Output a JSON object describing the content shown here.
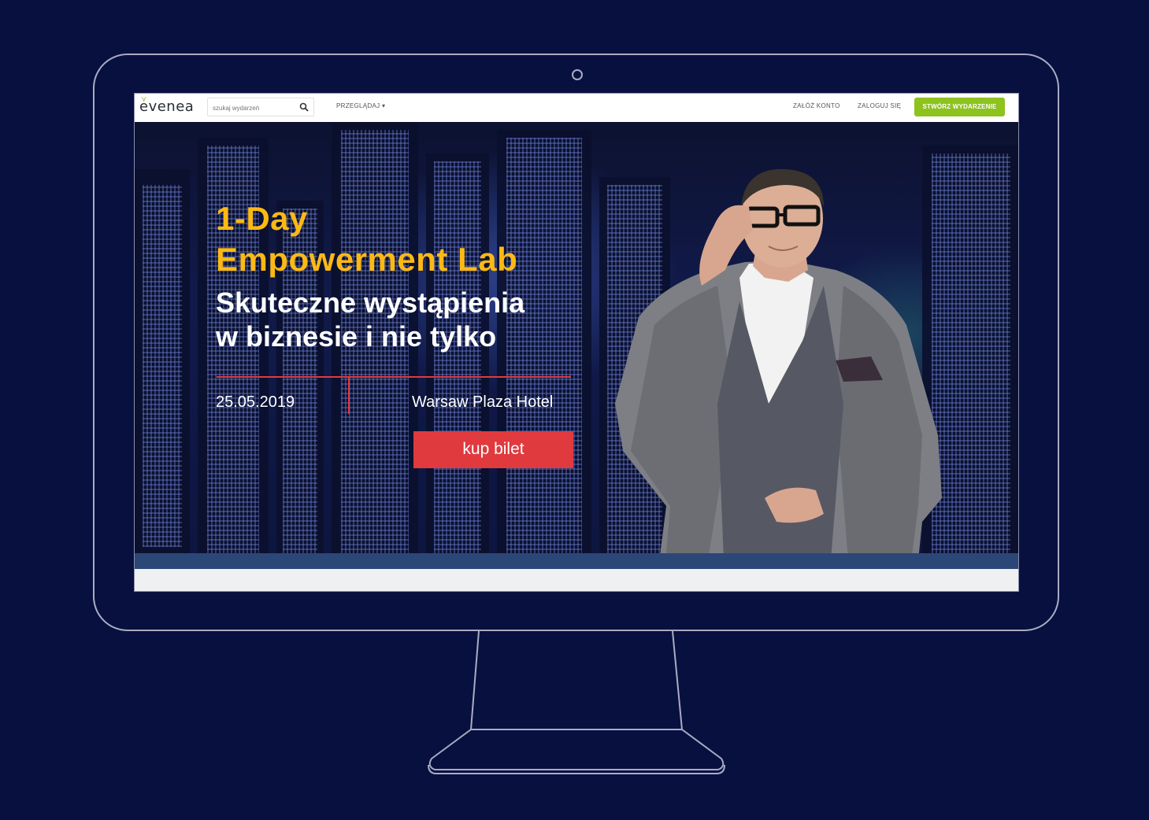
{
  "nav": {
    "logo": "evenea",
    "search_placeholder": "szukaj wydarzeń",
    "browse_label": "PRZEGLĄDAJ ▾",
    "register_label": "ZAŁÓŻ KONTO",
    "login_label": "ZALOGUJ SIĘ",
    "create_event_label": "STWÓRZ WYDARZENIE"
  },
  "hero": {
    "title_line1": "1-Day",
    "title_line2": "Empowerment Lab",
    "subtitle_line1": "Skuteczne wystąpienia",
    "subtitle_line2": "w biznesie i nie tylko",
    "date": "25.05.2019",
    "venue": "Warsaw Plaza Hotel",
    "buy_button": "kup bilet"
  },
  "colors": {
    "page_background": "#081040",
    "accent_title": "#fdb913",
    "accent_red": "#e03a3e",
    "brand_green": "#8dc21f"
  }
}
